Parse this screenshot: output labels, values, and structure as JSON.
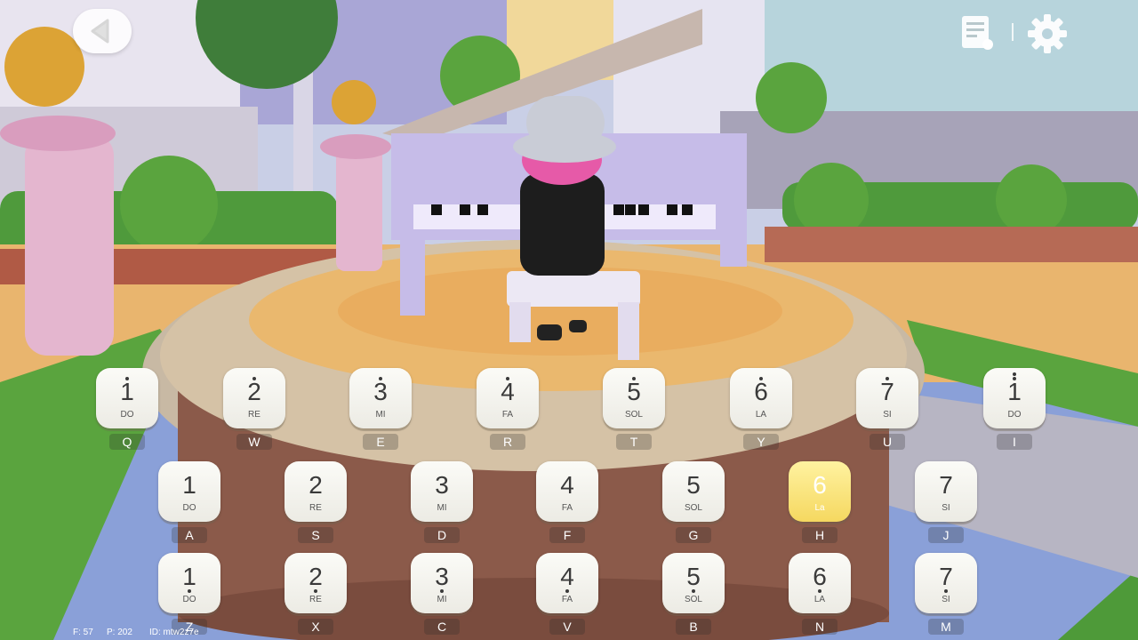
{
  "hud": {
    "back_icon": "chevron-left-icon",
    "sheet_icon": "music-sheet-icon",
    "settings_icon": "gear-icon"
  },
  "rows": [
    {
      "name": "high",
      "keys": [
        {
          "num": "1",
          "sol": "DO",
          "key": "Q"
        },
        {
          "num": "2",
          "sol": "RE",
          "key": "W"
        },
        {
          "num": "3",
          "sol": "MI",
          "key": "E"
        },
        {
          "num": "4",
          "sol": "FA",
          "key": "R"
        },
        {
          "num": "5",
          "sol": "SOL",
          "key": "T"
        },
        {
          "num": "6",
          "sol": "LA",
          "key": "Y"
        },
        {
          "num": "7",
          "sol": "SI",
          "key": "U"
        },
        {
          "num": "1",
          "sol": "DO",
          "key": "I"
        }
      ]
    },
    {
      "name": "middle",
      "keys": [
        {
          "num": "1",
          "sol": "DO",
          "key": "A"
        },
        {
          "num": "2",
          "sol": "RE",
          "key": "S"
        },
        {
          "num": "3",
          "sol": "MI",
          "key": "D"
        },
        {
          "num": "4",
          "sol": "FA",
          "key": "F"
        },
        {
          "num": "5",
          "sol": "SOL",
          "key": "G"
        },
        {
          "num": "6",
          "sol": "La",
          "key": "H",
          "active": true
        },
        {
          "num": "7",
          "sol": "SI",
          "key": "J"
        }
      ]
    },
    {
      "name": "low",
      "keys": [
        {
          "num": "1",
          "sol": "DO",
          "key": "Z"
        },
        {
          "num": "2",
          "sol": "RE",
          "key": "X"
        },
        {
          "num": "3",
          "sol": "MI",
          "key": "C"
        },
        {
          "num": "4",
          "sol": "FA",
          "key": "V"
        },
        {
          "num": "5",
          "sol": "SOL",
          "key": "B"
        },
        {
          "num": "6",
          "sol": "LA",
          "key": "N"
        },
        {
          "num": "7",
          "sol": "SI",
          "key": "M"
        }
      ]
    }
  ],
  "debug": {
    "fps": "F: 57",
    "ping": "P: 202",
    "id": "ID: mtw2z7e"
  },
  "colors": {
    "active_key": "#f5d860",
    "key_bg": "#f4f3ee",
    "sky": "#9fb4d6",
    "water": "#8aa0d8",
    "grass": "#5aa43e"
  }
}
